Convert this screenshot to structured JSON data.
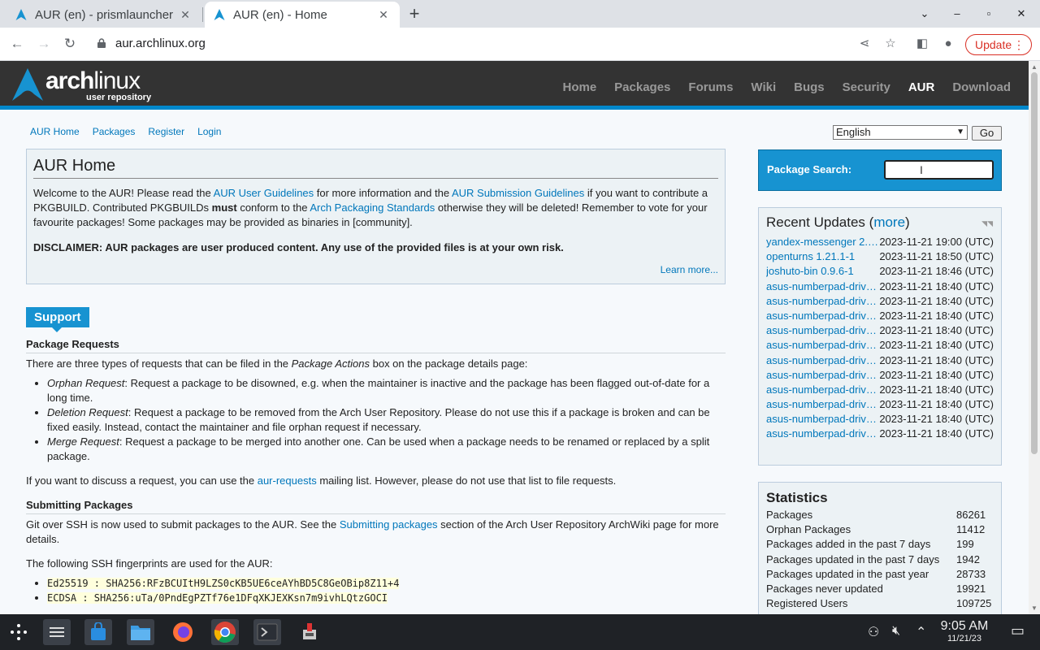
{
  "browser": {
    "tabs": [
      {
        "title": "AUR (en) - prismlauncher",
        "active": false
      },
      {
        "title": "AUR (en) - Home",
        "active": true
      }
    ],
    "url": "aur.archlinux.org",
    "update_label": "Update"
  },
  "header": {
    "logo_word": "arch",
    "logo_word2": "linux",
    "logo_sub": "user repository",
    "nav": [
      "Home",
      "Packages",
      "Forums",
      "Wiki",
      "Bugs",
      "Security",
      "AUR",
      "Download"
    ],
    "nav_selected": "AUR"
  },
  "subnav": [
    "AUR Home",
    "Packages",
    "Register",
    "Login"
  ],
  "language": {
    "selected": "English",
    "go_label": "Go"
  },
  "home": {
    "title": "AUR Home",
    "p1": {
      "t1": "Welcome to the AUR! Please read the ",
      "l1": "AUR User Guidelines",
      "t2": " for more information and the ",
      "l2": "AUR Submission Guidelines",
      "t3": " if you want to contribute a PKGBUILD. Contributed PKGBUILDs ",
      "b1": "must",
      "t4": " conform to the ",
      "l3": "Arch Packaging Standards",
      "t5": " otherwise they will be deleted! Remember to vote for your favourite packages! Some packages may be provided as binaries in [community]."
    },
    "disclaimer": "DISCLAIMER: AUR packages are user produced content. Any use of the provided files is at your own risk.",
    "learn_more": "Learn more..."
  },
  "support": {
    "tag": "Support",
    "requests_heading": "Package Requests",
    "requests_intro_1": "There are three types of requests that can be filed in the ",
    "requests_intro_em": "Package Actions",
    "requests_intro_2": " box on the package details page:",
    "request_types": [
      {
        "name": "Orphan Request",
        "text": ": Request a package to be disowned, e.g. when the maintainer is inactive and the package has been flagged out-of-date for a long time."
      },
      {
        "name": "Deletion Request",
        "text": ": Request a package to be removed from the Arch User Repository. Please do not use this if a package is broken and can be fixed easily. Instead, contact the maintainer and file orphan request if necessary."
      },
      {
        "name": "Merge Request",
        "text": ": Request a package to be merged into another one. Can be used when a package needs to be renamed or replaced by a split package."
      }
    ],
    "discuss_1": "If you want to discuss a request, you can use the ",
    "discuss_link": "aur-requests",
    "discuss_2": " mailing list. However, please do not use that list to file requests.",
    "submitting_heading": "Submitting Packages",
    "submit_1": "Git over SSH is now used to submit packages to the AUR. See the ",
    "submit_link": "Submitting packages",
    "submit_2": " section of the Arch User Repository ArchWiki page for more details.",
    "fingerprints_intro": "The following SSH fingerprints are used for the AUR:",
    "fingerprints": [
      "Ed25519 : SHA256:RFzBCUItH9LZS0cKB5UE6ceAYhBD5C8GeOBip8Z11+4",
      "ECDSA : SHA256:uTa/0PndEgPZTf76e1DFqXKJEXKsn7m9ivhLQtzGOCI"
    ]
  },
  "search": {
    "label": "Package Search:",
    "value": ""
  },
  "recent": {
    "title": "Recent Updates",
    "more_open": "(",
    "more": "more",
    "more_close": ")",
    "items": [
      {
        "name": "yandex-messenger 2.…",
        "date": "2023-11-21 19:00 (UTC)"
      },
      {
        "name": "openturns 1.21.1-1",
        "date": "2023-11-21 18:50 (UTC)"
      },
      {
        "name": "joshuto-bin 0.9.6-1",
        "date": "2023-11-21 18:46 (UTC)"
      },
      {
        "name": "asus-numberpad-driv…",
        "date": "2023-11-21 18:40 (UTC)"
      },
      {
        "name": "asus-numberpad-driv…",
        "date": "2023-11-21 18:40 (UTC)"
      },
      {
        "name": "asus-numberpad-driv…",
        "date": "2023-11-21 18:40 (UTC)"
      },
      {
        "name": "asus-numberpad-driv…",
        "date": "2023-11-21 18:40 (UTC)"
      },
      {
        "name": "asus-numberpad-driv…",
        "date": "2023-11-21 18:40 (UTC)"
      },
      {
        "name": "asus-numberpad-driv…",
        "date": "2023-11-21 18:40 (UTC)"
      },
      {
        "name": "asus-numberpad-driv…",
        "date": "2023-11-21 18:40 (UTC)"
      },
      {
        "name": "asus-numberpad-driv…",
        "date": "2023-11-21 18:40 (UTC)"
      },
      {
        "name": "asus-numberpad-driv…",
        "date": "2023-11-21 18:40 (UTC)"
      },
      {
        "name": "asus-numberpad-driv…",
        "date": "2023-11-21 18:40 (UTC)"
      },
      {
        "name": "asus-numberpad-driv…",
        "date": "2023-11-21 18:40 (UTC)"
      }
    ]
  },
  "stats": {
    "title": "Statistics",
    "rows": [
      {
        "k": "Packages",
        "v": "86261"
      },
      {
        "k": "Orphan Packages",
        "v": "11412"
      },
      {
        "k": "Packages added in the past 7 days",
        "v": "199"
      },
      {
        "k": "Packages updated in the past 7 days",
        "v": "1942"
      },
      {
        "k": "Packages updated in the past year",
        "v": "28733"
      },
      {
        "k": "Packages never updated",
        "v": "19921"
      },
      {
        "k": "Registered Users",
        "v": "109725"
      }
    ]
  },
  "taskbar": {
    "apps": [
      "app-launcher",
      "settings",
      "store",
      "files",
      "firefox",
      "chrome",
      "terminal",
      "tool"
    ],
    "time": "9:05 AM",
    "date": "11/21/23"
  },
  "colors": {
    "arch_blue": "#1793d1",
    "link": "#07b",
    "header_bg": "#333333"
  }
}
